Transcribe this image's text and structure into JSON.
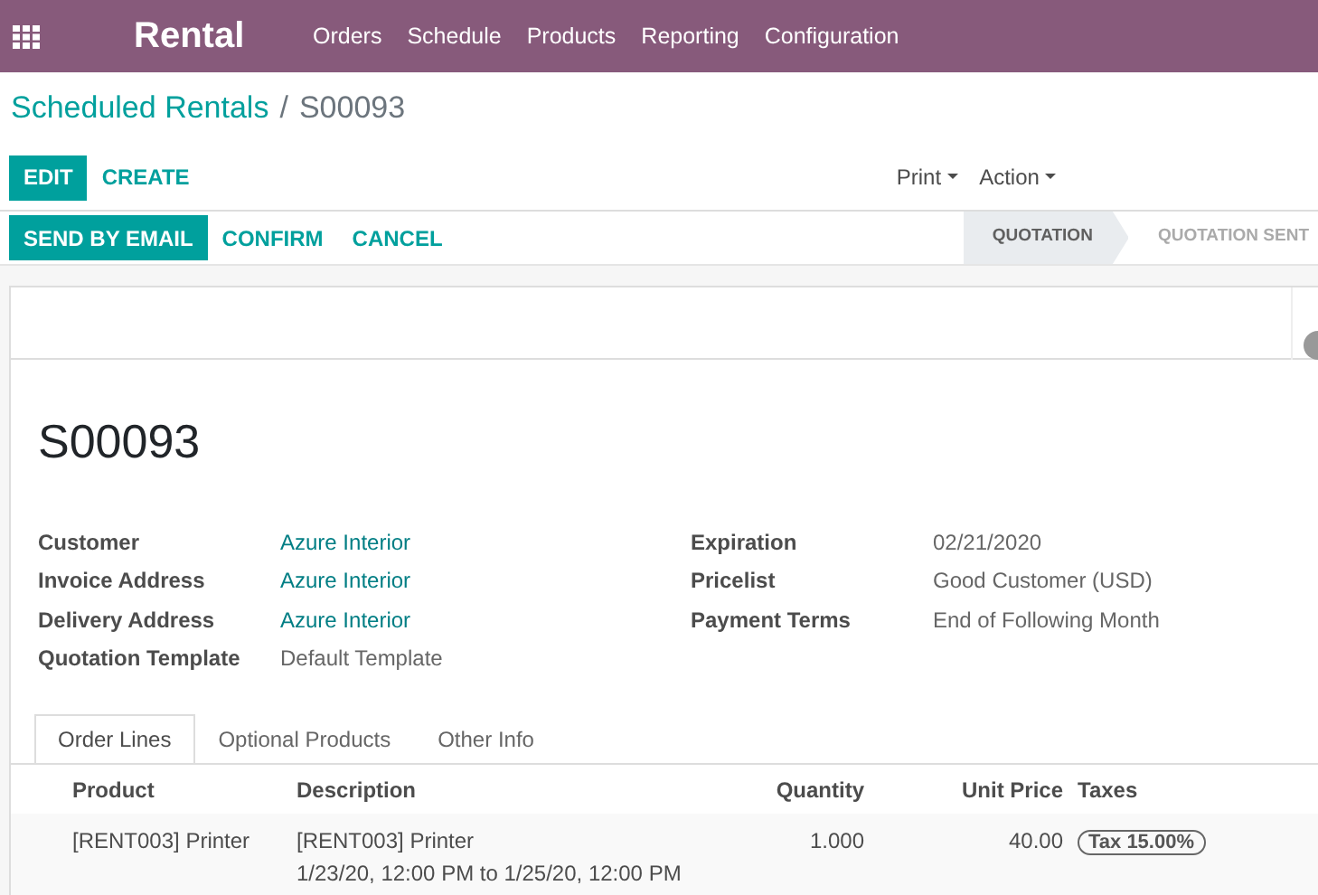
{
  "navbar": {
    "app_name": "Rental",
    "menu": [
      "Orders",
      "Schedule",
      "Products",
      "Reporting",
      "Configuration"
    ]
  },
  "breadcrumb": {
    "parent": "Scheduled Rentals",
    "separator": "/",
    "current": "S00093"
  },
  "control_buttons": [
    {
      "label": "EDIT",
      "primary": true
    },
    {
      "label": "CREATE",
      "primary": false
    }
  ],
  "dropdowns": [
    "Print",
    "Action"
  ],
  "action_buttons": [
    {
      "label": "SEND BY EMAIL",
      "primary": true
    },
    {
      "label": "CONFIRM",
      "primary": false
    },
    {
      "label": "CANCEL",
      "primary": false
    }
  ],
  "stages": [
    {
      "label": "QUOTATION",
      "selected": true
    },
    {
      "label": "QUOTATION SENT",
      "selected": false
    }
  ],
  "record": {
    "title": "S00093",
    "left_fields": [
      {
        "label": "Customer",
        "value": "Azure Interior",
        "kind": "link"
      },
      {
        "label": "Invoice Address",
        "value": "Azure Interior",
        "kind": "link"
      },
      {
        "label": "Delivery Address",
        "value": "Azure Interior",
        "kind": "link"
      },
      {
        "label": "Quotation Template",
        "value": "Default Template",
        "kind": "text"
      }
    ],
    "right_fields": [
      {
        "label": "Expiration",
        "value": "02/21/2020",
        "kind": "text"
      },
      {
        "label": "Pricelist",
        "value": "Good Customer (USD)",
        "kind": "text"
      },
      {
        "label": "Payment Terms",
        "value": "End of Following Month",
        "kind": "text"
      }
    ]
  },
  "tabs": [
    {
      "label": "Order Lines",
      "selected": true
    },
    {
      "label": "Optional Products",
      "selected": false
    },
    {
      "label": "Other Info",
      "selected": false
    }
  ],
  "table": {
    "columns": [
      "Product",
      "Description",
      "Quantity",
      "Unit Price",
      "Taxes"
    ],
    "rows": [
      {
        "product": "[RENT003] Printer",
        "description": [
          "[RENT003] Printer",
          "1/23/20, 12:00 PM to 1/25/20, 12:00 PM"
        ],
        "quantity": "1.000",
        "unit_price": "40.00",
        "taxes": "Tax 15.00%"
      }
    ]
  }
}
